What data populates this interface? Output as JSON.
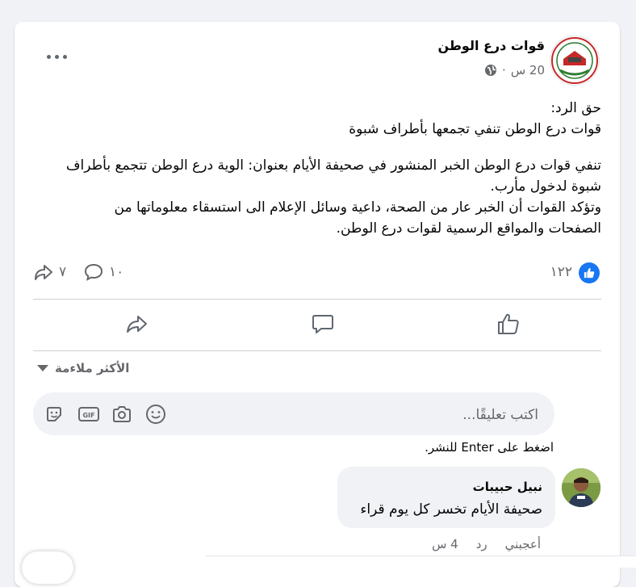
{
  "post": {
    "page_name": "قوات درع الوطن",
    "time": "20 س",
    "separator": "·",
    "privacy_icon": "globe-icon",
    "more_icon": "more-dots-icon",
    "heading_line1": "حق الرد:",
    "heading_line2": "قوات درع الوطن تنفي تجمعها بأطراف شبوة",
    "body_line1": "تنفي قوات درع الوطن الخبر المنشور في صحيفة الأيام بعنوان: الوية درع الوطن تتجمع بأطراف",
    "body_line2": "شبوة لدخول مأرب.",
    "body_line3": "وتؤكد القوات أن الخبر عار من الصحة، داعية وسائل الإعلام الى استسقاء معلوماتها من",
    "body_line4": "الصفحات والمواقع الرسمية لقوات درع الوطن."
  },
  "stats": {
    "likes": "١٢٢",
    "comments": "١٠",
    "shares": "٧"
  },
  "actions": {
    "like_icon": "like-icon",
    "comment_icon": "comment-icon",
    "share_icon": "share-icon"
  },
  "comments_section": {
    "sort_label": "الأكثر ملاءمة",
    "composer_placeholder": "اكتب تعليقًا...",
    "gif_label": "GIF",
    "enter_hint_pre": "اضغط على ",
    "enter_key": "Enter",
    "enter_hint_post": " للنشر."
  },
  "comment": {
    "author": "نبيل حبيبات",
    "text": "صحيفة الأيام تخسر كل يوم قراء",
    "like_label": "أعجبني",
    "reply_label": "رد",
    "time": "4 س"
  },
  "colors": {
    "accent": "#1877f2",
    "secondary_text": "#65676b",
    "background": "#f0f2f5"
  }
}
